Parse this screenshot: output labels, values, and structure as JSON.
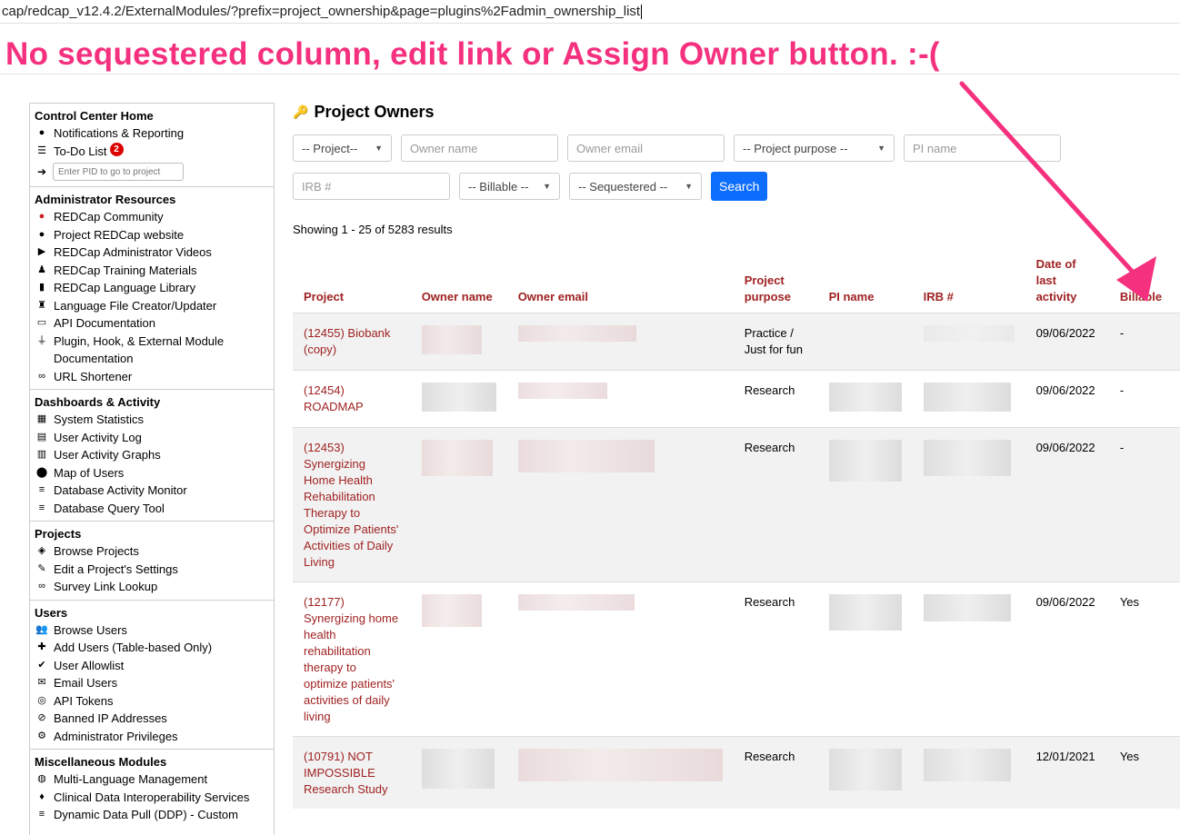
{
  "browser": {
    "url": "cap/redcap_v12.4.2/ExternalModules/?prefix=project_ownership&page=plugins%2Fadmin_ownership_list"
  },
  "annotation": {
    "text": "No sequestered column, edit link or Assign Owner button. :-(",
    "color": "#f5307e"
  },
  "sidebar": {
    "control_center": {
      "title": "Control Center Home",
      "notifications": "Notifications & Reporting",
      "todo": "To-Do List",
      "todo_badge": "2",
      "pid_placeholder": "Enter PID to go to project"
    },
    "admin_resources": {
      "title": "Administrator Resources",
      "items": [
        "REDCap Community",
        "Project REDCap website",
        "REDCap Administrator Videos",
        "REDCap Training Materials",
        "REDCap Language Library",
        "Language File Creator/Updater",
        "API Documentation",
        "Plugin, Hook, & External Module Documentation",
        "URL Shortener"
      ]
    },
    "dashboards": {
      "title": "Dashboards & Activity",
      "items": [
        "System Statistics",
        "User Activity Log",
        "User Activity Graphs",
        "Map of Users",
        "Database Activity Monitor",
        "Database Query Tool"
      ]
    },
    "projects": {
      "title": "Projects",
      "items": [
        "Browse Projects",
        "Edit a Project's Settings",
        "Survey Link Lookup"
      ]
    },
    "users": {
      "title": "Users",
      "items": [
        "Browse Users",
        "Add Users (Table-based Only)",
        "User Allowlist",
        "Email Users",
        "API Tokens",
        "Banned IP Addresses",
        "Administrator Privileges"
      ]
    },
    "misc": {
      "title": "Miscellaneous Modules",
      "items": [
        "Multi-Language Management",
        "Clinical Data Interoperability Services",
        "Dynamic Data Pull (DDP) - Custom"
      ]
    }
  },
  "main": {
    "title": "Project Owners",
    "filters": {
      "project": "-- Project--",
      "owner_name": "Owner name",
      "owner_email": "Owner email",
      "purpose": "-- Project purpose --",
      "pi_name": "PI name",
      "irb": "IRB #",
      "billable": "-- Billable --",
      "sequestered": "-- Sequestered --",
      "search_button": "Search"
    },
    "showing": "Showing 1 - 25 of 5283 results",
    "columns": {
      "project": "Project",
      "owner_name": "Owner name",
      "owner_email": "Owner email",
      "purpose": "Project purpose",
      "pi_name": "PI name",
      "irb": "IRB #",
      "last_activity": "Date of last activity",
      "billable": "Billable"
    },
    "rows": [
      {
        "project": "(12455) Biobank (copy)",
        "purpose": "Practice / Just for fun",
        "date": "09/06/2022",
        "billable": "-"
      },
      {
        "project": "(12454) ROADMAP",
        "purpose": "Research",
        "date": "09/06/2022",
        "billable": "-"
      },
      {
        "project": "(12453) Synergizing Home Health Rehabilitation Therapy to Optimize Patients' Activities of Daily Living",
        "purpose": "Research",
        "date": "09/06/2022",
        "billable": "-"
      },
      {
        "project": "(12177) Synergizing home health rehabilitation therapy to optimize patients' activities of daily living",
        "purpose": "Research",
        "date": "09/06/2022",
        "billable": "Yes"
      },
      {
        "project": "(10791) NOT IMPOSSIBLE Research Study",
        "purpose": "Research",
        "date": "12/01/2021",
        "billable": "Yes"
      }
    ]
  }
}
